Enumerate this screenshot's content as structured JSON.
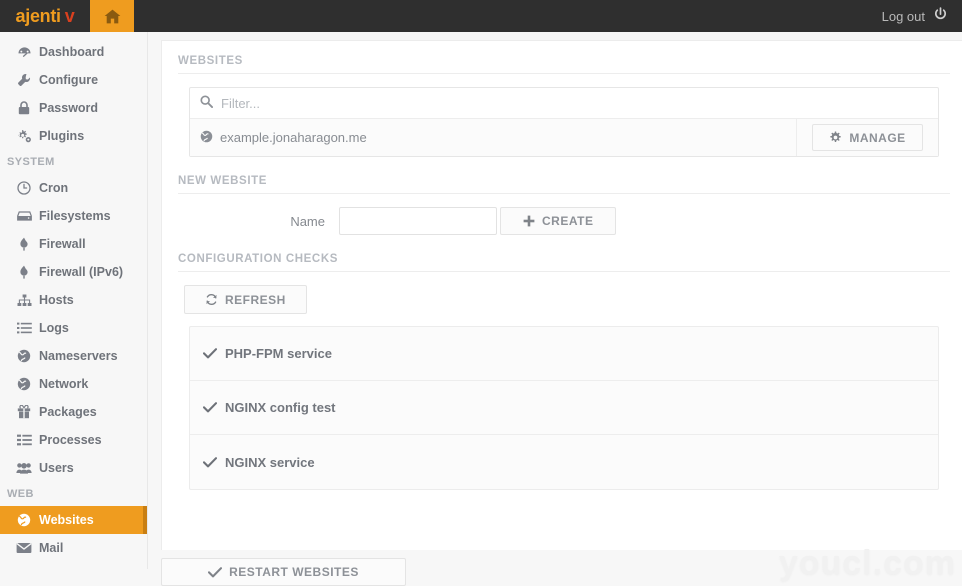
{
  "topbar": {
    "brand_name": "ajenti",
    "brand_suffix": "v",
    "home_icon": "home-icon",
    "logout_label": "Log out",
    "logout_icon": "power-icon",
    "bg_color": "#2f2f2f",
    "accent_color": "#ef9c1f",
    "brand_suffix_color": "#d9401f"
  },
  "sidebar": {
    "items": [
      {
        "label": "Dashboard",
        "icon": "dashboard-icon",
        "active": false
      },
      {
        "label": "Configure",
        "icon": "wrench-icon",
        "active": false
      },
      {
        "label": "Password",
        "icon": "lock-icon",
        "active": false
      },
      {
        "label": "Plugins",
        "icon": "gears-icon",
        "active": false
      }
    ],
    "sections": [
      {
        "title": "SYSTEM",
        "items": [
          {
            "label": "Cron",
            "icon": "clock-icon",
            "active": false
          },
          {
            "label": "Filesystems",
            "icon": "hdd-icon",
            "active": false
          },
          {
            "label": "Firewall",
            "icon": "fire-icon",
            "active": false
          },
          {
            "label": "Firewall (IPv6)",
            "icon": "fire-icon",
            "active": false
          },
          {
            "label": "Hosts",
            "icon": "sitemap-icon",
            "active": false
          },
          {
            "label": "Logs",
            "icon": "list-icon",
            "active": false
          },
          {
            "label": "Nameservers",
            "icon": "globe-icon",
            "active": false
          },
          {
            "label": "Network",
            "icon": "globe-icon",
            "active": false
          },
          {
            "label": "Packages",
            "icon": "gift-icon",
            "active": false
          },
          {
            "label": "Processes",
            "icon": "tasklist-icon",
            "active": false
          },
          {
            "label": "Users",
            "icon": "users-icon",
            "active": false
          }
        ]
      },
      {
        "title": "WEB",
        "items": [
          {
            "label": "Websites",
            "icon": "globe-icon",
            "active": true
          },
          {
            "label": "Mail",
            "icon": "envelope-icon",
            "active": false
          }
        ]
      }
    ],
    "active_bg_color": "#ef9c1f",
    "active_text_color": "#ffffff"
  },
  "websites": {
    "section_title": "WEBSITES",
    "filter": {
      "icon": "search-icon",
      "placeholder": "Filter...",
      "value": ""
    },
    "rows": [
      {
        "icon": "globe-icon",
        "name": "example.jonaharagon.me",
        "manage_label": "MANAGE",
        "manage_icon": "gear-icon"
      }
    ]
  },
  "new_website": {
    "section_title": "NEW WEBSITE",
    "name_label": "Name",
    "name_value": "",
    "name_placeholder": "",
    "create_label": "CREATE",
    "create_icon": "plus-icon"
  },
  "configuration_checks": {
    "section_title": "CONFIGURATION CHECKS",
    "refresh_label": "REFRESH",
    "refresh_icon": "refresh-icon",
    "items": [
      {
        "label": "PHP-FPM service",
        "icon": "check-icon",
        "status": "ok"
      },
      {
        "label": "NGINX config test",
        "icon": "check-icon",
        "status": "ok"
      },
      {
        "label": "NGINX service",
        "icon": "check-icon",
        "status": "ok"
      }
    ]
  },
  "footer": {
    "restart_label": "RESTART WEBSITES",
    "restart_icon": "check-icon"
  },
  "watermark": {
    "text": "youcl.com"
  }
}
